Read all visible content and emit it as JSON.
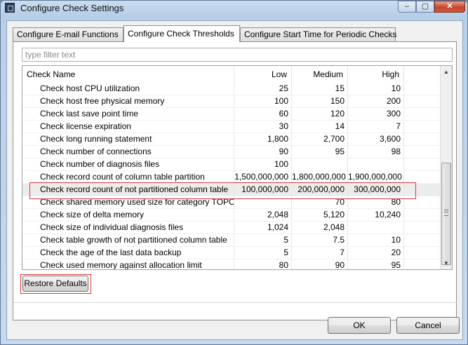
{
  "window": {
    "title": "Configure Check Settings",
    "controls": {
      "minimize": "–",
      "maximize": "▢",
      "close": "✕"
    }
  },
  "tabs": [
    {
      "label": "Configure E-mail Functions",
      "active": false
    },
    {
      "label": "Configure Check Thresholds",
      "active": true
    },
    {
      "label": "Configure Start Time for Periodic Checks",
      "active": false
    }
  ],
  "filter": {
    "placeholder": "type filter text",
    "value": ""
  },
  "table": {
    "columns": {
      "name": "Check Name",
      "low": "Low",
      "medium": "Medium",
      "high": "High"
    },
    "rows": [
      {
        "name": "Check host CPU utilization",
        "low": "25",
        "medium": "15",
        "high": "10"
      },
      {
        "name": "Check host free physical memory",
        "low": "100",
        "medium": "150",
        "high": "200"
      },
      {
        "name": "Check last save point time",
        "low": "60",
        "medium": "120",
        "high": "300"
      },
      {
        "name": "Check license expiration",
        "low": "30",
        "medium": "14",
        "high": "7"
      },
      {
        "name": "Check long running statement",
        "low": "1,800",
        "medium": "2,700",
        "high": "3,600"
      },
      {
        "name": "Check number of connections",
        "low": "90",
        "medium": "95",
        "high": "98"
      },
      {
        "name": "Check number of diagnosis files",
        "low": "100",
        "medium": "",
        "high": ""
      },
      {
        "name": "Check record count of column table partition",
        "low": "1,500,000,000",
        "medium": "1,800,000,000",
        "high": "1,900,000,000"
      },
      {
        "name": "Check record count of not partitioned column table",
        "low": "100,000,000",
        "medium": "200,000,000",
        "high": "300,000,000",
        "selected": true
      },
      {
        "name": "Check shared memory used size for category TOPOLOGY",
        "low": "",
        "medium": "70",
        "high": "80"
      },
      {
        "name": "Check size of delta memory",
        "low": "2,048",
        "medium": "5,120",
        "high": "10,240"
      },
      {
        "name": "Check size of individual diagnosis files",
        "low": "1,024",
        "medium": "2,048",
        "high": ""
      },
      {
        "name": "Check table growth of not partitioned column table",
        "low": "5",
        "medium": "7.5",
        "high": "10"
      },
      {
        "name": "Check the age of the last data backup",
        "low": "5",
        "medium": "7",
        "high": "20"
      },
      {
        "name": "Check used memory against allocation limit",
        "low": "80",
        "medium": "90",
        "high": "95"
      }
    ]
  },
  "scrollbar": {
    "up_glyph": "▲",
    "down_glyph": "▼"
  },
  "buttons": {
    "restore_defaults": "Restore Defaults",
    "ok": "OK",
    "cancel": "Cancel"
  },
  "colors": {
    "highlight": "#d23b3b",
    "selected_row": "#ececec"
  }
}
